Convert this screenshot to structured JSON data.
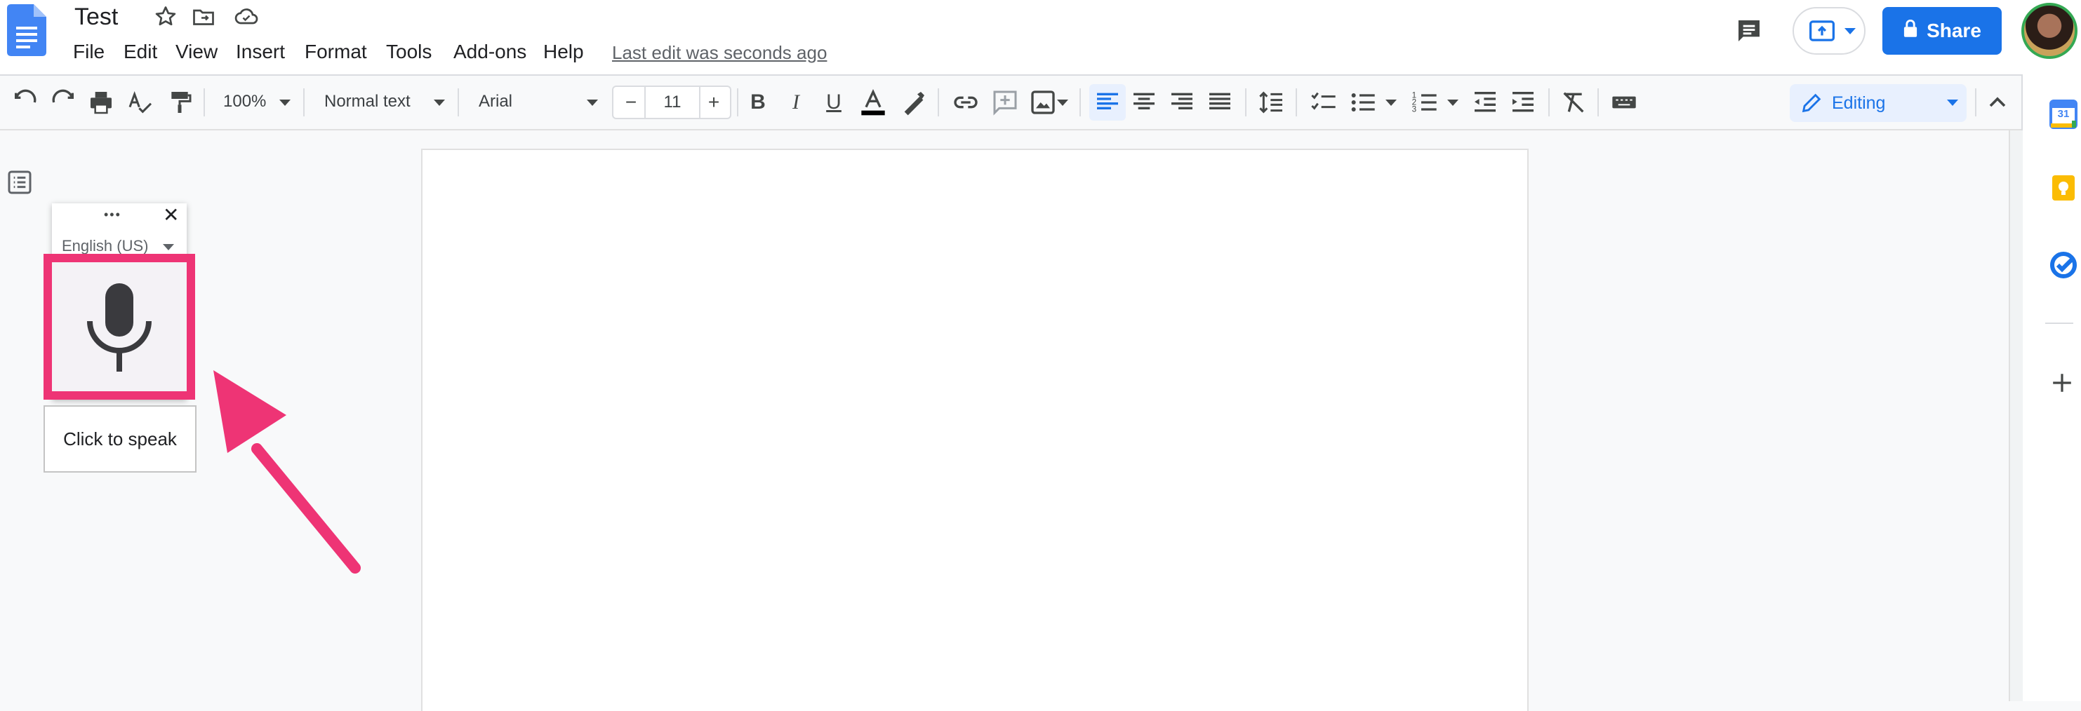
{
  "document": {
    "title": "Test",
    "menus": [
      "File",
      "Edit",
      "View",
      "Insert",
      "Format",
      "Tools",
      "Add-ons",
      "Help"
    ],
    "last_edit": "Last edit was seconds ago"
  },
  "header": {
    "share_label": "Share"
  },
  "toolbar": {
    "zoom": "100%",
    "style": "Normal text",
    "font": "Arial",
    "font_size": "11",
    "editing_mode": "Editing"
  },
  "voice_typing": {
    "language": "English (US)",
    "tooltip": "Click to speak",
    "more_glyph": "•••",
    "close_glyph": "✕"
  },
  "side_panel": {
    "calendar_day": "31"
  },
  "colors": {
    "accent": "#1a73e8",
    "highlight_annotation": "#ee3475",
    "keep_yellow": "#fbbc04"
  },
  "icons": [
    "docs-logo-icon",
    "star-icon",
    "move-folder-icon",
    "cloud-saved-icon",
    "comments-icon",
    "present-icon",
    "lock-icon",
    "undo-icon",
    "redo-icon",
    "print-icon",
    "spellcheck-icon",
    "paint-format-icon",
    "bold-icon",
    "italic-icon",
    "underline-icon",
    "text-color-icon",
    "highlight-icon",
    "link-icon",
    "add-comment-icon",
    "image-icon",
    "align-left-icon",
    "align-center-icon",
    "align-right-icon",
    "justify-icon",
    "line-spacing-icon",
    "checklist-icon",
    "bullet-list-icon",
    "numbered-list-icon",
    "decrease-indent-icon",
    "increase-indent-icon",
    "clear-formatting-icon",
    "input-tools-icon",
    "pencil-icon",
    "collapse-icon",
    "outline-icon",
    "microphone-icon",
    "calendar-icon",
    "keep-icon",
    "tasks-icon",
    "plus-icon",
    "arrow-annotation"
  ]
}
